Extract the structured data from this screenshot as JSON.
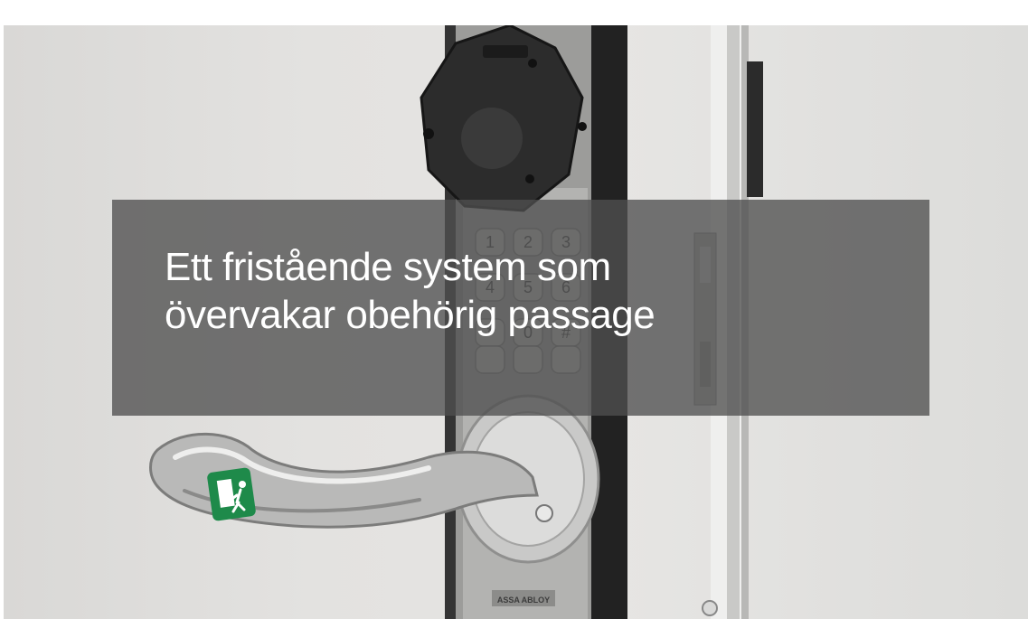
{
  "hero": {
    "headline_line1": "Ett fristående system som",
    "headline_line2": "övervakar obehörig passage",
    "lock_brand": "ASSA ABLOY",
    "keypad_keys": [
      "1",
      "2",
      "3",
      "4",
      "5",
      "6",
      "*",
      "0",
      "#"
    ],
    "overlay_color": "#505050",
    "text_color": "#ffffff",
    "exit_sign_color": "#1e8a4a"
  }
}
